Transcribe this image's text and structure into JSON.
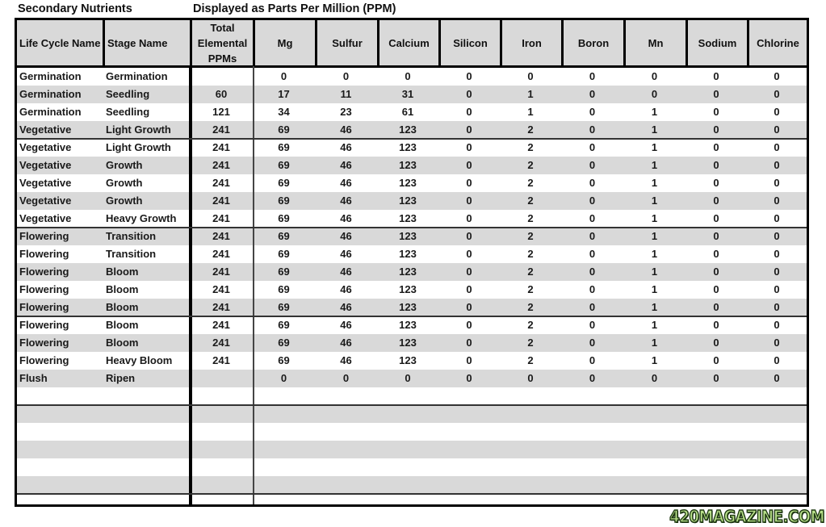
{
  "titles": {
    "left": "Secondary Nutrients",
    "right": "Displayed as Parts Per Million (PPM)"
  },
  "table": {
    "headers": [
      "Life Cycle Name",
      "Stage Name",
      "Total Elemental PPMs",
      "Mg",
      "Sulfur",
      "Calcium",
      "Silicon",
      "Iron",
      "Boron",
      "Mn",
      "Sodium",
      "Chlorine"
    ],
    "rows": [
      [
        "Germination",
        "Germination",
        "",
        "0",
        "0",
        "0",
        "0",
        "0",
        "0",
        "0",
        "0",
        "0"
      ],
      [
        "Germination",
        "Seedling",
        "60",
        "17",
        "11",
        "31",
        "0",
        "1",
        "0",
        "0",
        "0",
        "0"
      ],
      [
        "Germination",
        "Seedling",
        "121",
        "34",
        "23",
        "61",
        "0",
        "1",
        "0",
        "1",
        "0",
        "0"
      ],
      [
        "Vegetative",
        "Light Growth",
        "241",
        "69",
        "46",
        "123",
        "0",
        "2",
        "0",
        "1",
        "0",
        "0"
      ],
      [
        "Vegetative",
        "Light Growth",
        "241",
        "69",
        "46",
        "123",
        "0",
        "2",
        "0",
        "1",
        "0",
        "0"
      ],
      [
        "Vegetative",
        "Growth",
        "241",
        "69",
        "46",
        "123",
        "0",
        "2",
        "0",
        "1",
        "0",
        "0"
      ],
      [
        "Vegetative",
        "Growth",
        "241",
        "69",
        "46",
        "123",
        "0",
        "2",
        "0",
        "1",
        "0",
        "0"
      ],
      [
        "Vegetative",
        "Growth",
        "241",
        "69",
        "46",
        "123",
        "0",
        "2",
        "0",
        "1",
        "0",
        "0"
      ],
      [
        "Vegetative",
        "Heavy Growth",
        "241",
        "69",
        "46",
        "123",
        "0",
        "2",
        "0",
        "1",
        "0",
        "0"
      ],
      [
        "Flowering",
        "Transition",
        "241",
        "69",
        "46",
        "123",
        "0",
        "2",
        "0",
        "1",
        "0",
        "0"
      ],
      [
        "Flowering",
        "Transition",
        "241",
        "69",
        "46",
        "123",
        "0",
        "2",
        "0",
        "1",
        "0",
        "0"
      ],
      [
        "Flowering",
        "Bloom",
        "241",
        "69",
        "46",
        "123",
        "0",
        "2",
        "0",
        "1",
        "0",
        "0"
      ],
      [
        "Flowering",
        "Bloom",
        "241",
        "69",
        "46",
        "123",
        "0",
        "2",
        "0",
        "1",
        "0",
        "0"
      ],
      [
        "Flowering",
        "Bloom",
        "241",
        "69",
        "46",
        "123",
        "0",
        "2",
        "0",
        "1",
        "0",
        "0"
      ],
      [
        "Flowering",
        "Bloom",
        "241",
        "69",
        "46",
        "123",
        "0",
        "2",
        "0",
        "1",
        "0",
        "0"
      ],
      [
        "Flowering",
        "Bloom",
        "241",
        "69",
        "46",
        "123",
        "0",
        "2",
        "0",
        "1",
        "0",
        "0"
      ],
      [
        "Flowering",
        "Heavy Bloom",
        "241",
        "69",
        "46",
        "123",
        "0",
        "2",
        "0",
        "1",
        "0",
        "0"
      ],
      [
        "Flush",
        "Ripen",
        "",
        "0",
        "0",
        "0",
        "0",
        "0",
        "0",
        "0",
        "0",
        "0"
      ]
    ],
    "empty_rows": 7,
    "colors": {
      "stripe": "#d9d9d9",
      "border": "#000000"
    }
  },
  "watermark": "420MAGAZINE.COM"
}
